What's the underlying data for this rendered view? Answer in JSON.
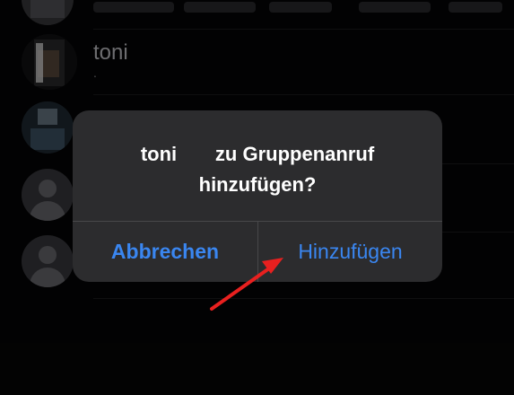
{
  "contacts": [
    {
      "name": "",
      "has_photo": true
    },
    {
      "name": "toni",
      "sub": ".",
      "has_photo": true
    },
    {
      "name": "",
      "has_photo": true
    },
    {
      "name": "",
      "has_photo": false
    },
    {
      "name": "",
      "has_photo": false
    }
  ],
  "dialog": {
    "title_line1": "toni       zu Gruppenanruf",
    "title_line2": "hinzufügen?",
    "cancel_label": "Abbrechen",
    "confirm_label": "Hinzufügen"
  },
  "colors": {
    "background": "#050506",
    "dialog_bg": "#2c2c2e",
    "button_blue": "#3a86f0",
    "arrow_red": "#e8201f"
  },
  "icons": {
    "placeholder_avatar": "person-silhouette-icon",
    "annotation": "red-arrow-icon"
  }
}
